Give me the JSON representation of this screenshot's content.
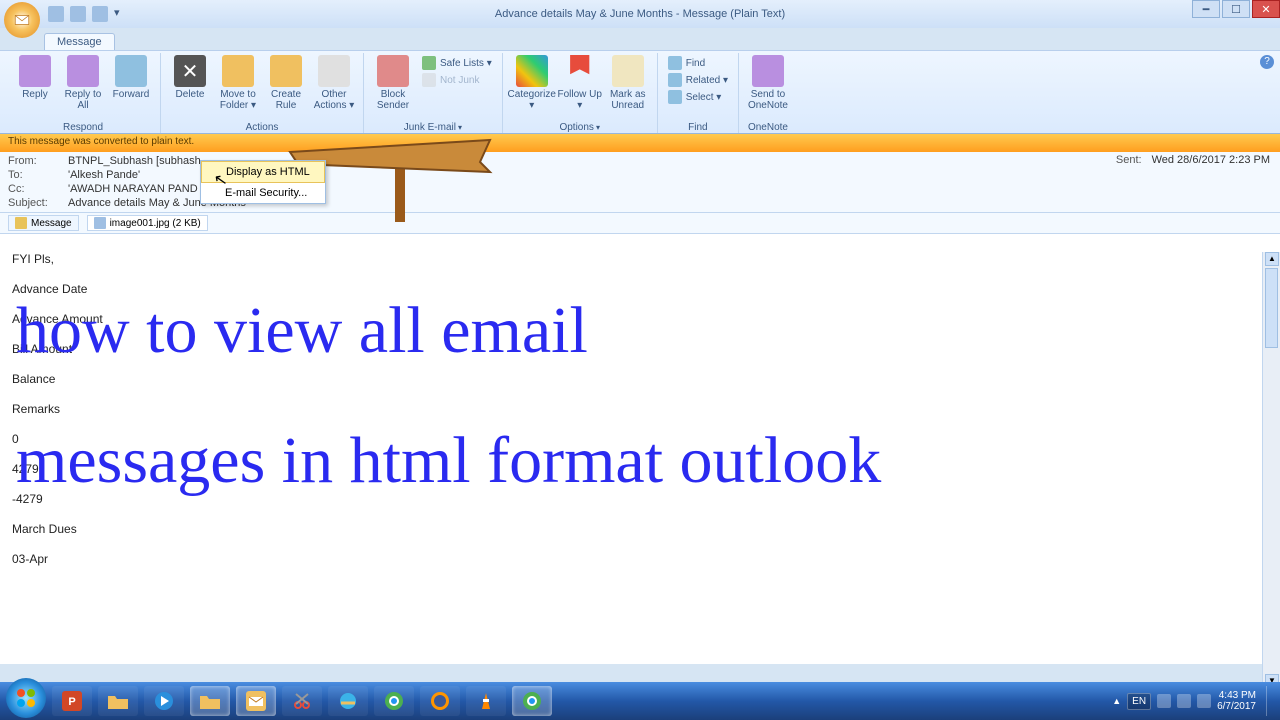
{
  "window": {
    "title": "Advance details May & June Months - Message (Plain Text)"
  },
  "tabs": {
    "message": "Message"
  },
  "ribbon": {
    "respond": {
      "label": "Respond",
      "reply": "Reply",
      "reply_all": "Reply to All",
      "forward": "Forward"
    },
    "actions": {
      "label": "Actions",
      "delete": "Delete",
      "move": "Move to Folder ▾",
      "rule": "Create Rule",
      "other": "Other Actions ▾"
    },
    "junk": {
      "label": "Junk E-mail",
      "block": "Block Sender",
      "safe": "Safe Lists ▾",
      "notjunk": "Not Junk"
    },
    "options": {
      "label": "Options",
      "categorize": "Categorize ▾",
      "followup": "Follow Up ▾",
      "unread": "Mark as Unread"
    },
    "find": {
      "label": "Find",
      "find": "Find",
      "related": "Related ▾",
      "select": "Select ▾"
    },
    "onenote": {
      "label": "OneNote",
      "send": "Send to OneNote"
    }
  },
  "infobar": "This message was converted to plain text.",
  "header": {
    "from_label": "From:",
    "from": "BTNPL_Subhash [subhash",
    "to_label": "To:",
    "to": "'Alkesh Pande'",
    "cc_label": "Cc:",
    "cc": "'AWADH NARAYAN PAND",
    "subject_label": "Subject:",
    "subject": "Advance details May & June Months",
    "sent_label": "Sent:",
    "sent": "Wed 28/6/2017 2:23 PM"
  },
  "attachments": {
    "message": "Message",
    "file": "image001.jpg (2 KB)"
  },
  "context_menu": {
    "display_html": "Display as HTML",
    "email_security": "E-mail Security..."
  },
  "body_lines": {
    "l0": "FYI Pls,",
    "l1": "",
    "l2": "Advance Date",
    "l3": "Advance Amount",
    "l4": "Bill Amount",
    "l5": "Balance",
    "l6": "Remarks",
    "l7": "",
    "l8": "0",
    "l9": "4279",
    "l10": "-4279",
    "l11": "March Dues",
    "l12": "03-Apr"
  },
  "overlay": {
    "line1": "how to view all email",
    "line2": "messages in html format outlook"
  },
  "tray": {
    "lang": "EN",
    "time": "4:43 PM",
    "date": "6/7/2017"
  }
}
